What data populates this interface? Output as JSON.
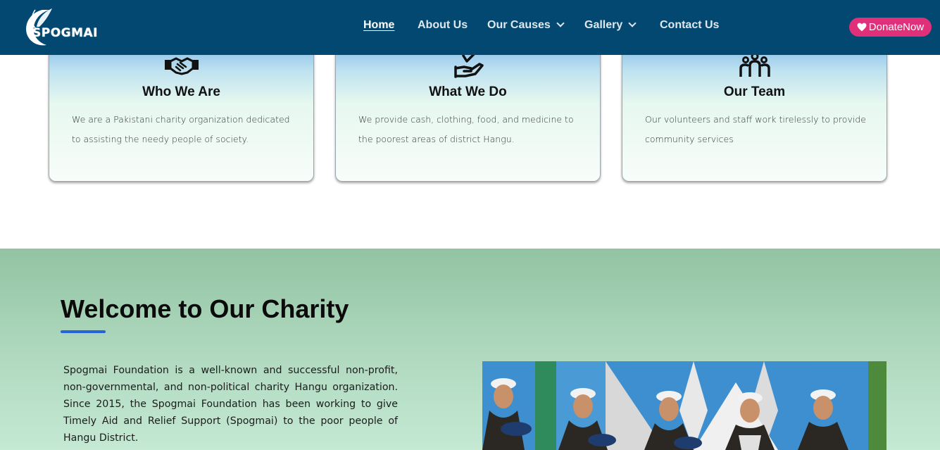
{
  "brand": {
    "name": "SPOGMAI"
  },
  "nav": {
    "items": [
      {
        "label": "Home",
        "active": true
      },
      {
        "label": "About Us"
      },
      {
        "label": "Our Causes",
        "dropdown": true
      },
      {
        "label": "Gallery",
        "dropdown": true
      },
      {
        "label": "Contact Us"
      }
    ],
    "donate_label": "DonateNow"
  },
  "cards": [
    {
      "icon": "handshake-icon",
      "title": "Who We Are",
      "text": "We are a Pakistani charity organization dedicated to assisting the needy people of society."
    },
    {
      "icon": "giving-hand-icon",
      "title": "What We Do",
      "text": "We provide cash, clothing, food, and medicine to the poorest areas of district Hangu."
    },
    {
      "icon": "team-icon",
      "title": "Our Team",
      "text": "Our volunteers and staff work tirelessly to provide community services"
    }
  ],
  "welcome": {
    "title": "Welcome to Our Charity",
    "text": "Spogmai Foundation is a well-known and successful non-profit, non-governmental, and non-political charity Hangu organization. Since 2015, the Spogmai Foundation has been working to give Timely Aid and Relief Support (Spogmai) to the poor people of Hangu District."
  },
  "colors": {
    "navbar": "#034870",
    "donate": "#e0307a",
    "accent_bar": "#2563d8",
    "section_bg": "#a9d4b8"
  }
}
